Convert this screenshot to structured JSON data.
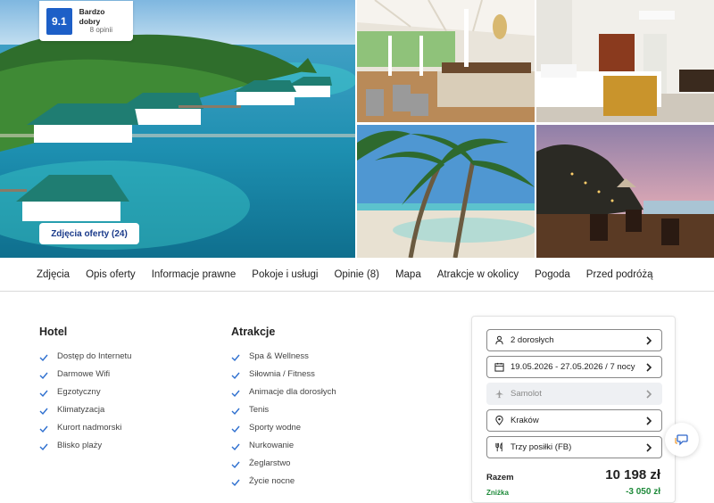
{
  "gallery": {
    "rating": {
      "score": "9.1",
      "label": "Bardzo dobry",
      "count": "8 opinii"
    },
    "photos_button": "Zdjęcia oferty (24)"
  },
  "tabs": [
    "Zdjęcia",
    "Opis oferty",
    "Informacje prawne",
    "Pokoje i usługi",
    "Opinie (8)",
    "Mapa",
    "Atrakcje w okolicy",
    "Pogoda",
    "Przed podróżą"
  ],
  "hotel": {
    "title": "Hotel",
    "features": [
      "Dostęp do Internetu",
      "Darmowe Wifi",
      "Egzotyczny",
      "Klimatyzacja",
      "Kurort nadmorski",
      "Blisko plaży"
    ]
  },
  "attractions": {
    "title": "Atrakcje",
    "features": [
      "Spa & Wellness",
      "Siłownia / Fitness",
      "Animacje dla dorosłych",
      "Tenis",
      "Sporty wodne",
      "Nurkowanie",
      "Żeglarstwo",
      "Życie nocne"
    ]
  },
  "booking": {
    "travelers": "2 dorosłych",
    "dates": "19.05.2026 - 27.05.2026 / 7 nocy",
    "transport": "Samolot",
    "departure": "Kraków",
    "meals": "Trzy posiłki (FB)",
    "total_label": "Razem",
    "total_value": "10 198 zł",
    "discount_label": "Zniżka",
    "discount_value": "-3 050 zł"
  },
  "colors": {
    "accent": "#1d5fc7",
    "discount": "#1e8a3a"
  },
  "icons": {
    "check": "check-icon",
    "user": "user-icon",
    "calendar": "calendar-icon",
    "plane": "plane-icon",
    "location": "location-pin-icon",
    "meals": "cutlery-icon",
    "chevron": "chevron-right-icon",
    "chat": "chat-icon"
  }
}
